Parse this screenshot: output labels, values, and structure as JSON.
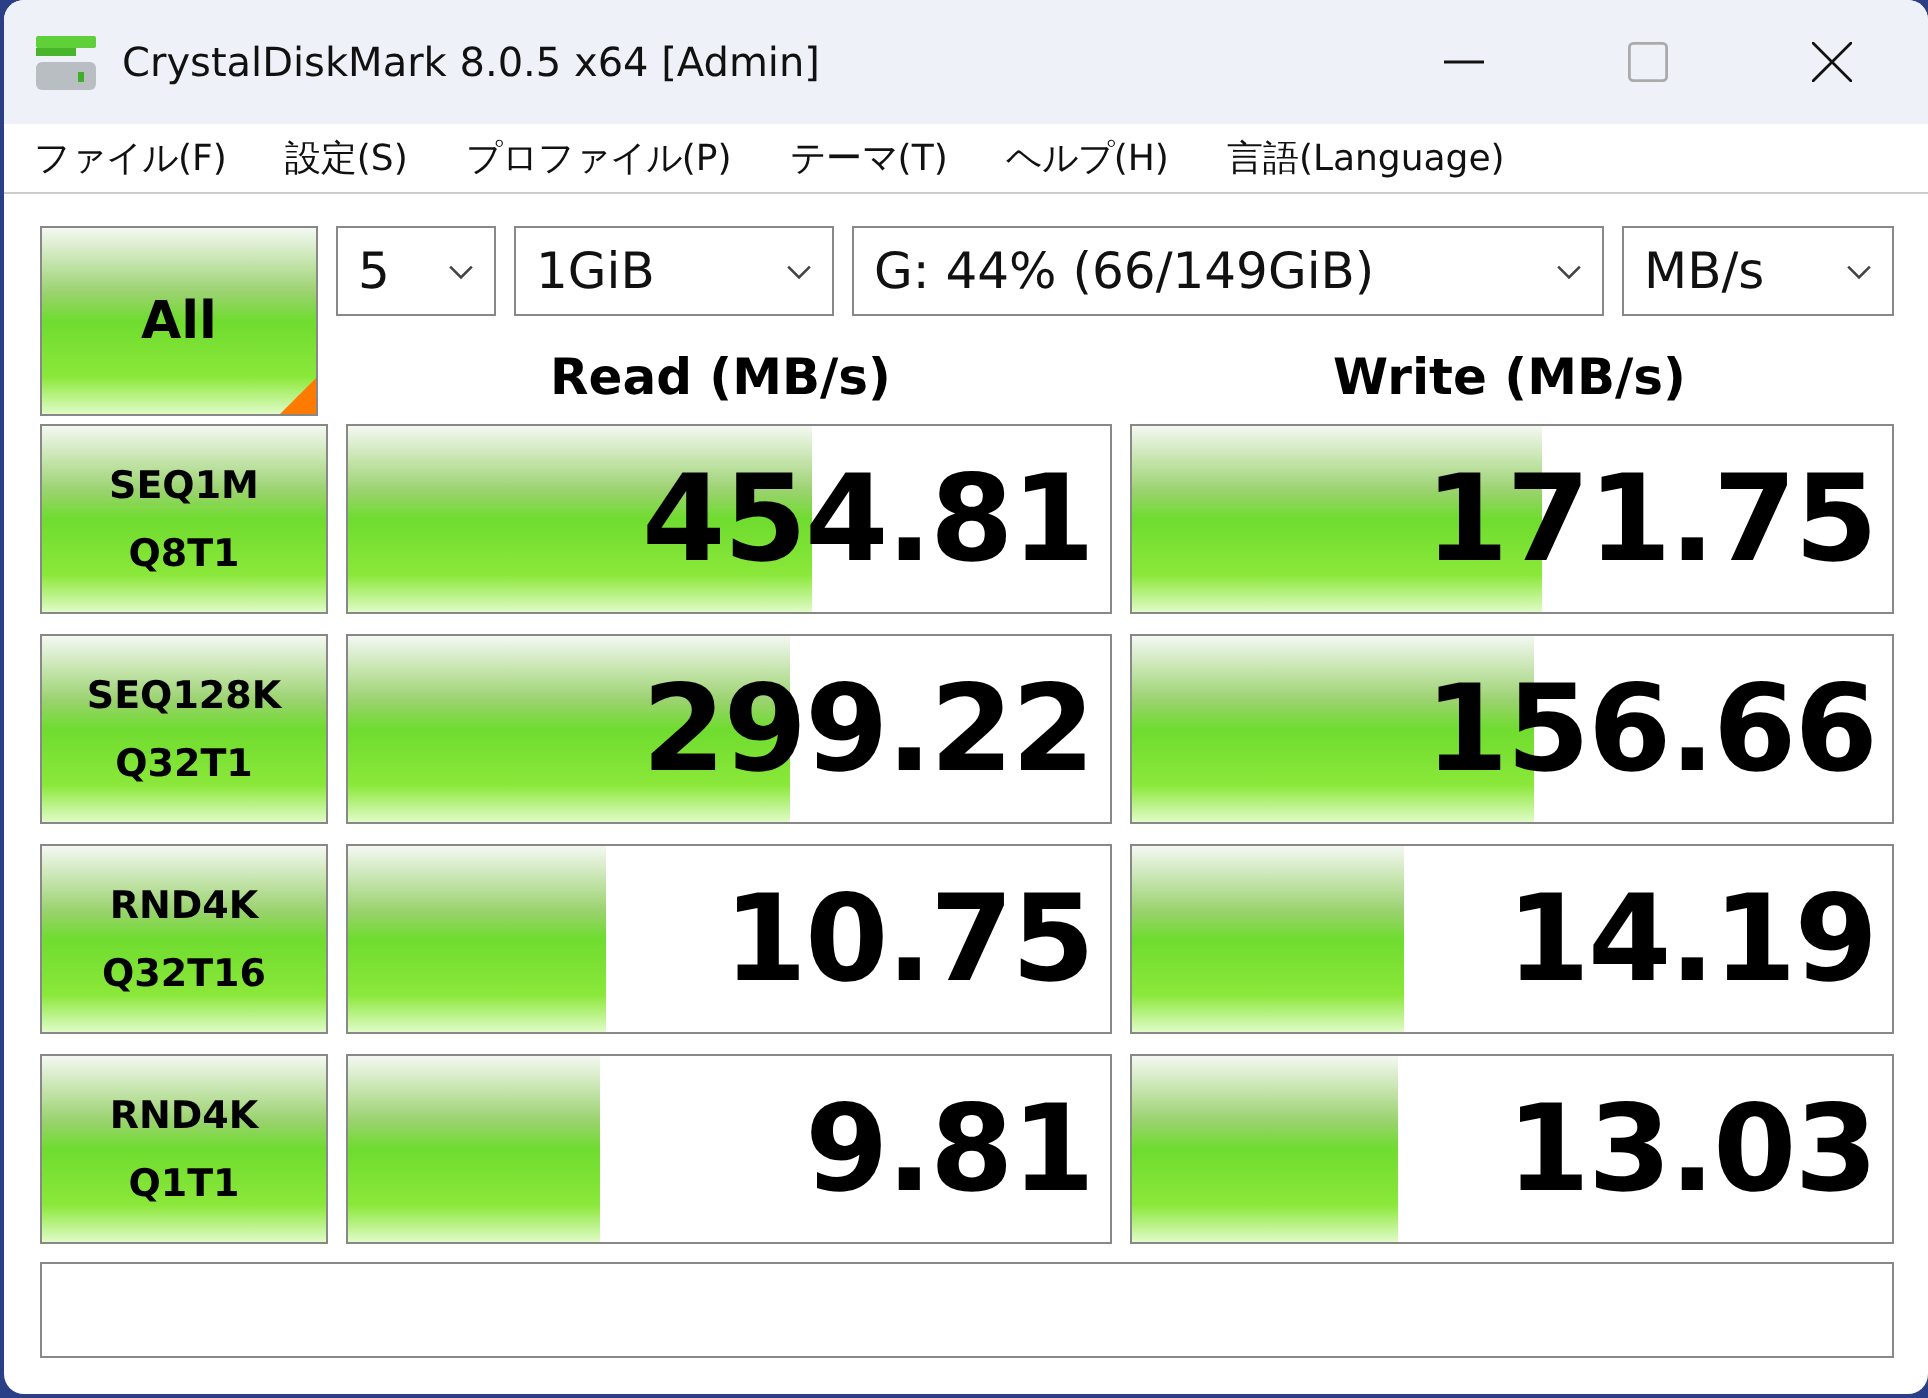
{
  "window": {
    "title": "CrystalDiskMark 8.0.5 x64 [Admin]"
  },
  "menu": [
    "ファイル(F)",
    "設定(S)",
    "プロファイル(P)",
    "テーマ(T)",
    "ヘルプ(H)",
    "言語(Language)"
  ],
  "all_button": {
    "label": "All"
  },
  "settings": [
    {
      "value": "5"
    },
    {
      "value": "1GiB"
    },
    {
      "value": "G: 44% (66/149GiB)"
    },
    {
      "value": "MB/s"
    }
  ],
  "columns": [
    "Read (MB/s)",
    "Write (MB/s)"
  ],
  "rows": [
    {
      "test": [
        "SEQ1M",
        "Q8T1"
      ],
      "read": {
        "reading": "454.81",
        "level": 0.61
      },
      "write": {
        "reading": "171.75",
        "level": 0.54
      }
    },
    {
      "test": [
        "SEQ128K",
        "Q32T1"
      ],
      "read": {
        "reading": "299.22",
        "level": 0.58
      },
      "write": {
        "reading": "156.66",
        "level": 0.53
      }
    },
    {
      "test": [
        "RND4K",
        "Q32T16"
      ],
      "read": {
        "reading": "10.75",
        "level": 0.34
      },
      "write": {
        "reading": "14.19",
        "level": 0.36
      }
    },
    {
      "test": [
        "RND4K",
        "Q1T1"
      ],
      "read": {
        "reading": "9.81",
        "level": 0.33
      },
      "write": {
        "reading": "13.03",
        "level": 0.35
      }
    }
  ]
}
